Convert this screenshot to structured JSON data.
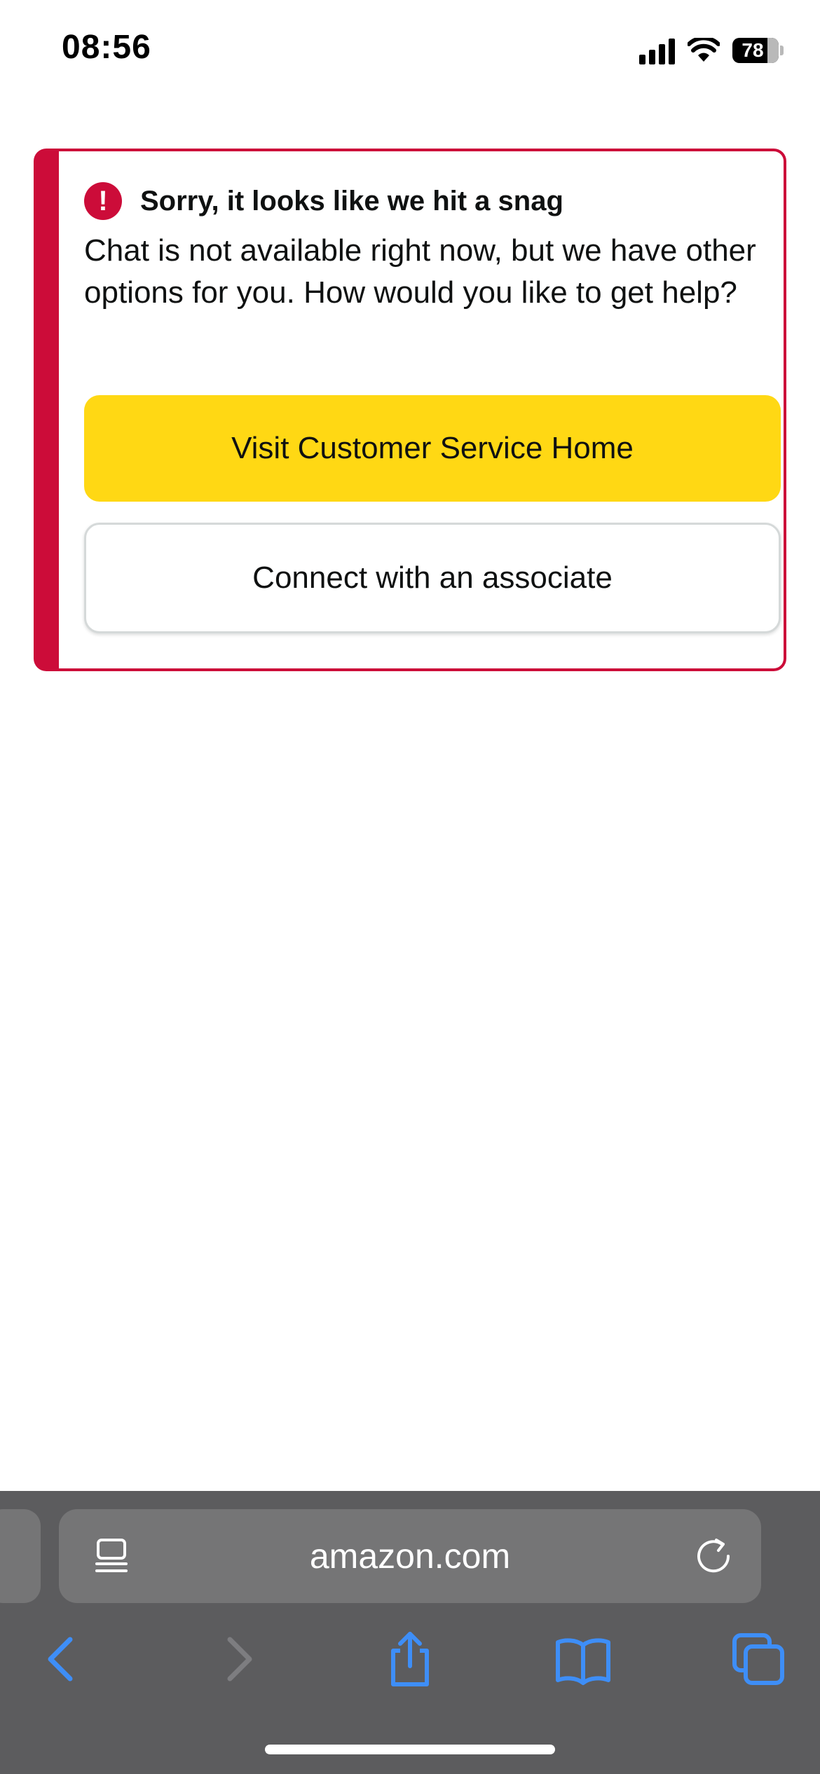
{
  "status_bar": {
    "time": "08:56",
    "battery_level": "78",
    "icons": [
      "signal-icon",
      "wifi-icon",
      "battery-icon"
    ]
  },
  "alert": {
    "icon": "exclamation-circle-icon",
    "icon_glyph": "!",
    "title": "Sorry, it looks like we hit a snag",
    "message": "Chat is not available right now, but we have other options for you. How would you like to get help?",
    "primary_button_label": "Visit Customer Service Home",
    "secondary_button_label": "Connect with an associate"
  },
  "browser": {
    "address": "amazon.com",
    "icons": [
      "reader-icon",
      "reload-icon",
      "back-icon",
      "forward-icon",
      "share-icon",
      "bookmarks-icon",
      "tabs-icon"
    ]
  },
  "colors": {
    "alert_red": "#cc0c39",
    "button_yellow": "#ffd814",
    "toolbar_blue": "#3e8ef7",
    "toolbar_gray": "#5c5c5e"
  }
}
